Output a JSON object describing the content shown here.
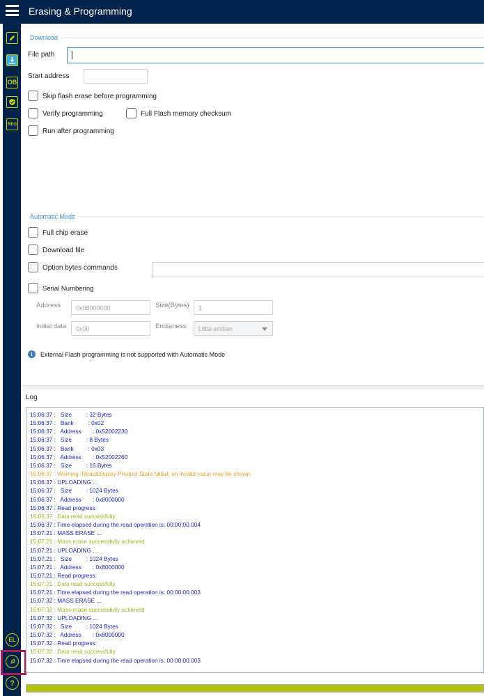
{
  "header": {
    "title": "Erasing & Programming"
  },
  "sidebar": {
    "items": [
      {
        "name": "edit-icon",
        "label": ""
      },
      {
        "name": "download-icon",
        "label": ""
      },
      {
        "name": "ob-icon",
        "label": "OB"
      },
      {
        "name": "shield-icon",
        "label": ""
      },
      {
        "name": "reg-icon",
        "label": "REG"
      }
    ],
    "bottom": [
      {
        "name": "el-icon",
        "label": "EL"
      },
      {
        "name": "plug-icon",
        "label": ""
      },
      {
        "name": "help-icon",
        "label": "?"
      }
    ]
  },
  "download": {
    "group_title": "Download",
    "file_path_label": "File path",
    "file_path_value": "",
    "start_address_label": "Start address",
    "start_address_value": "",
    "skip_erase_label": "Skip flash erase before programming",
    "verify_label": "Verify programming",
    "full_checksum_label": "Full Flash memory checksum",
    "run_after_label": "Run after programming"
  },
  "automatic": {
    "group_title": "Automatic Mode",
    "full_chip_erase_label": "Full chip erase",
    "download_file_label": "Download file",
    "option_bytes_label": "Option bytes commands",
    "option_bytes_value": "",
    "serial_numbering_label": "Serial Numbering",
    "address_label": "Address",
    "address_value": "0x08000000",
    "size_label": "Size(Bytes)",
    "size_value": "1",
    "initial_data_label": "Initial data",
    "initial_data_value": "0x00",
    "endianess_label": "Endianess",
    "endianess_value": "Little-endian",
    "note": "External Flash programming is not supported with Automatic Mode"
  },
  "log": {
    "title": "Log",
    "lines": [
      {
        "type": "info",
        "text": "15:06:37 :   Size         : 32 Bytes"
      },
      {
        "type": "info",
        "text": "15:06:37 :   Bank         : 0x02"
      },
      {
        "type": "info",
        "text": "15:06:37 :   Address       : 0x52002230"
      },
      {
        "type": "info",
        "text": "15:06:37 :   Size         : 8 Bytes"
      },
      {
        "type": "info",
        "text": "15:06:37 :   Bank         : 0x03"
      },
      {
        "type": "info",
        "text": "15:06:37 :   Address       : 0x52002260"
      },
      {
        "type": "info",
        "text": "15:06:37 :   Size         : 16 Bytes"
      },
      {
        "type": "warning",
        "text": "15:06:37 : Warning: Read/Display Product State failed, an invalid value may be shown."
      },
      {
        "type": "info",
        "text": "15:06:37 : UPLOADING ..."
      },
      {
        "type": "info",
        "text": "15:06:37 :   Size         : 1024 Bytes"
      },
      {
        "type": "info",
        "text": "15:06:37 :   Address       : 0x8000000"
      },
      {
        "type": "info",
        "text": "15:06:37 : Read progress:"
      },
      {
        "type": "success",
        "text": "15:06:37 : Data read successfully"
      },
      {
        "type": "info",
        "text": "15:06:37 : Time elapsed during the read operation is: 00:00:00.004"
      },
      {
        "type": "info",
        "text": "15:07:21 : MASS ERASE ..."
      },
      {
        "type": "success",
        "text": "15:07:21 : Mass erase successfully achieved"
      },
      {
        "type": "info",
        "text": "15:07:21 : UPLOADING ..."
      },
      {
        "type": "info",
        "text": "15:07:21 :   Size         : 1024 Bytes"
      },
      {
        "type": "info",
        "text": "15:07:21 :   Address       : 0x8000000"
      },
      {
        "type": "info",
        "text": "15:07:21 : Read progress:"
      },
      {
        "type": "success",
        "text": "15:07:21 : Data read successfully"
      },
      {
        "type": "info",
        "text": "15:07:21 : Time elapsed during the read operation is: 00:00:00.003"
      },
      {
        "type": "info",
        "text": "15:07:32 : MASS ERASE ..."
      },
      {
        "type": "success",
        "text": "15:07:32 : Mass erase successfully achieved"
      },
      {
        "type": "info",
        "text": "15:07:32 : UPLOADING ..."
      },
      {
        "type": "info",
        "text": "15:07:32 :   Size         : 1024 Bytes"
      },
      {
        "type": "info",
        "text": "15:07:32 :   Address       : 0x8000000"
      },
      {
        "type": "info",
        "text": "15:07:32 : Read progress:"
      },
      {
        "type": "success",
        "text": "15:07:32 : Data read successfully"
      },
      {
        "type": "info",
        "text": "15:07:32 : Time elapsed during the read operation is: 00:00:00.003"
      }
    ]
  },
  "progress": {
    "percent": 100
  },
  "colors": {
    "header_bg": "#03234b",
    "accent_lime": "#c8d400",
    "info_text": "#1a27c9",
    "success_text": "#a3b41e",
    "warning_text": "#f0a020",
    "group_title": "#3c8dc8",
    "highlight": "#b0185a"
  }
}
